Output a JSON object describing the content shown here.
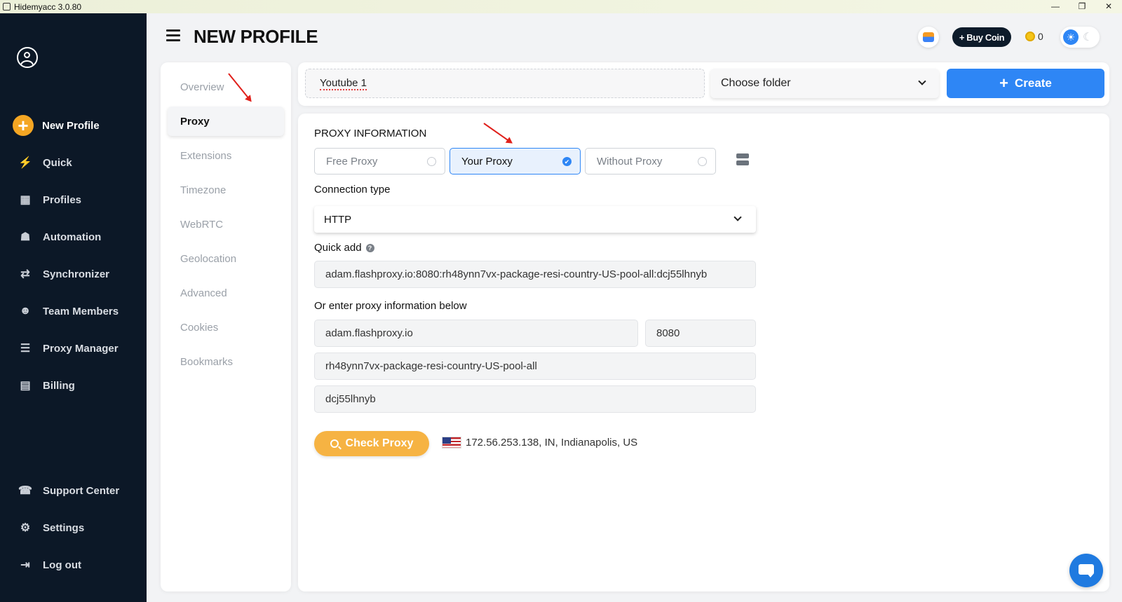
{
  "window": {
    "title": "Hidemyacc 3.0.80",
    "controls": [
      "—",
      "❐",
      "✕"
    ]
  },
  "sidebar": {
    "items": [
      {
        "label": "New Profile",
        "icon": "plus-circle-icon"
      },
      {
        "label": "Quick",
        "icon": "lightning-icon"
      },
      {
        "label": "Profiles",
        "icon": "grid-icon"
      },
      {
        "label": "Automation",
        "icon": "robot-icon"
      },
      {
        "label": "Synchronizer",
        "icon": "sync-icon"
      },
      {
        "label": "Team Members",
        "icon": "team-icon"
      },
      {
        "label": "Proxy Manager",
        "icon": "server-icon"
      },
      {
        "label": "Billing",
        "icon": "billing-icon"
      },
      {
        "label": "Support Center",
        "icon": "support-icon"
      },
      {
        "label": "Settings",
        "icon": "gear-icon"
      },
      {
        "label": "Log out",
        "icon": "logout-icon"
      }
    ]
  },
  "header": {
    "title": "NEW PROFILE",
    "buy_coin_label": "+ Buy Coin",
    "coin_count": "0"
  },
  "tabs": [
    {
      "label": "Overview"
    },
    {
      "label": "Proxy",
      "active": true
    },
    {
      "label": "Extensions"
    },
    {
      "label": "Timezone"
    },
    {
      "label": "WebRTC"
    },
    {
      "label": "Geolocation"
    },
    {
      "label": "Advanced"
    },
    {
      "label": "Cookies"
    },
    {
      "label": "Bookmarks"
    }
  ],
  "topbar": {
    "profile_name": "Youtube 1",
    "folder_placeholder": "Choose folder",
    "create_label": "Create"
  },
  "proxy": {
    "section_title": "PROXY INFORMATION",
    "options": [
      {
        "label": "Free Proxy",
        "selected": false
      },
      {
        "label": "Your Proxy",
        "selected": true
      },
      {
        "label": "Without Proxy",
        "selected": false
      }
    ],
    "connection_type_label": "Connection type",
    "connection_type": "HTTP",
    "quick_add_label": "Quick add",
    "quick_add_value": "adam.flashproxy.io:8080:rh48ynn7vx-package-resi-country-US-pool-all:dcj55lhnyb",
    "manual_label": "Or enter proxy information below",
    "host": "adam.flashproxy.io",
    "port": "8080",
    "username": "rh48ynn7vx-package-resi-country-US-pool-all",
    "password": "dcj55lhnyb",
    "check_label": "Check Proxy",
    "result": "172.56.253.138, IN, Indianapolis, US"
  },
  "colors": {
    "sidebar_bg": "#0c1827",
    "accent_blue": "#2e86f5",
    "accent_orange": "#f6b343"
  }
}
